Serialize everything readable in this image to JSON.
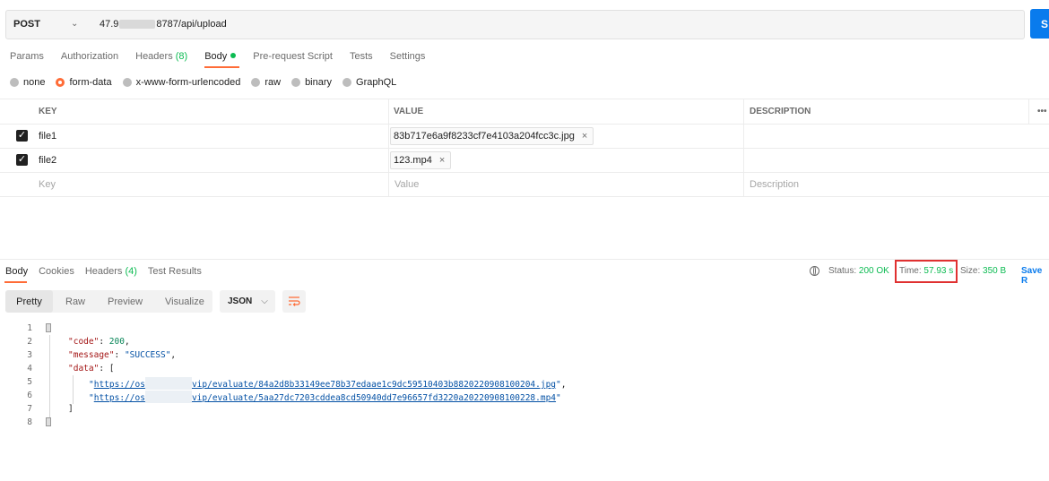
{
  "request": {
    "method": "POST",
    "url_prefix": "47.9",
    "url_suffix": "8787/api/upload",
    "send_label": "S"
  },
  "tabs": [
    {
      "label": "Params"
    },
    {
      "label": "Authorization"
    },
    {
      "label": "Headers",
      "count": "(8)"
    },
    {
      "label": "Body"
    },
    {
      "label": "Pre-request Script"
    },
    {
      "label": "Tests"
    },
    {
      "label": "Settings"
    }
  ],
  "body_types": {
    "none": "none",
    "form_data": "form-data",
    "urlencoded": "x-www-form-urlencoded",
    "raw": "raw",
    "binary": "binary",
    "graphql": "GraphQL",
    "selected": "form-data"
  },
  "table": {
    "headers": {
      "key": "KEY",
      "value": "VALUE",
      "description": "DESCRIPTION",
      "more": "•••"
    },
    "rows": [
      {
        "key": "file1",
        "value": "83b717e6a9f8233cf7e4103a204fcc3c.jpg",
        "checked": true
      },
      {
        "key": "file2",
        "value": "123.mp4",
        "checked": true
      }
    ],
    "placeholders": {
      "key": "Key",
      "value": "Value",
      "description": "Description"
    },
    "remove_glyph": "×",
    "check_glyph": "✓"
  },
  "response": {
    "tabs": [
      {
        "label": "Body"
      },
      {
        "label": "Cookies"
      },
      {
        "label": "Headers",
        "count": "(4)"
      },
      {
        "label": "Test Results"
      }
    ],
    "status_label": "Status:",
    "status_value": "200 OK",
    "time_label": "Time:",
    "time_value": "57.93 s",
    "size_label": "Size:",
    "size_value": "350 B",
    "save_label": "Save R",
    "views": {
      "pretty": "Pretty",
      "raw": "Raw",
      "preview": "Preview",
      "visualize": "Visualize"
    },
    "format": "JSON",
    "chevron": "⌵"
  },
  "code": {
    "line_numbers": [
      "1",
      "2",
      "3",
      "4",
      "5",
      "6",
      "7",
      "8"
    ],
    "code_key": "\"code\"",
    "code_val": "200",
    "message_key": "\"message\"",
    "message_val": "\"SUCCESS\"",
    "data_key": "\"data\"",
    "link1_a": "https://os",
    "link1_b": "vip/evaluate/84a2d8b33149ee78b37edaae1c9dc59510403b8820220908100204.jpg",
    "link2_a": "https://os",
    "link2_b": "vip/evaluate/5aa27dc7203cddea8cd50940dd7e96657fd3220a20220908100228.mp4"
  }
}
